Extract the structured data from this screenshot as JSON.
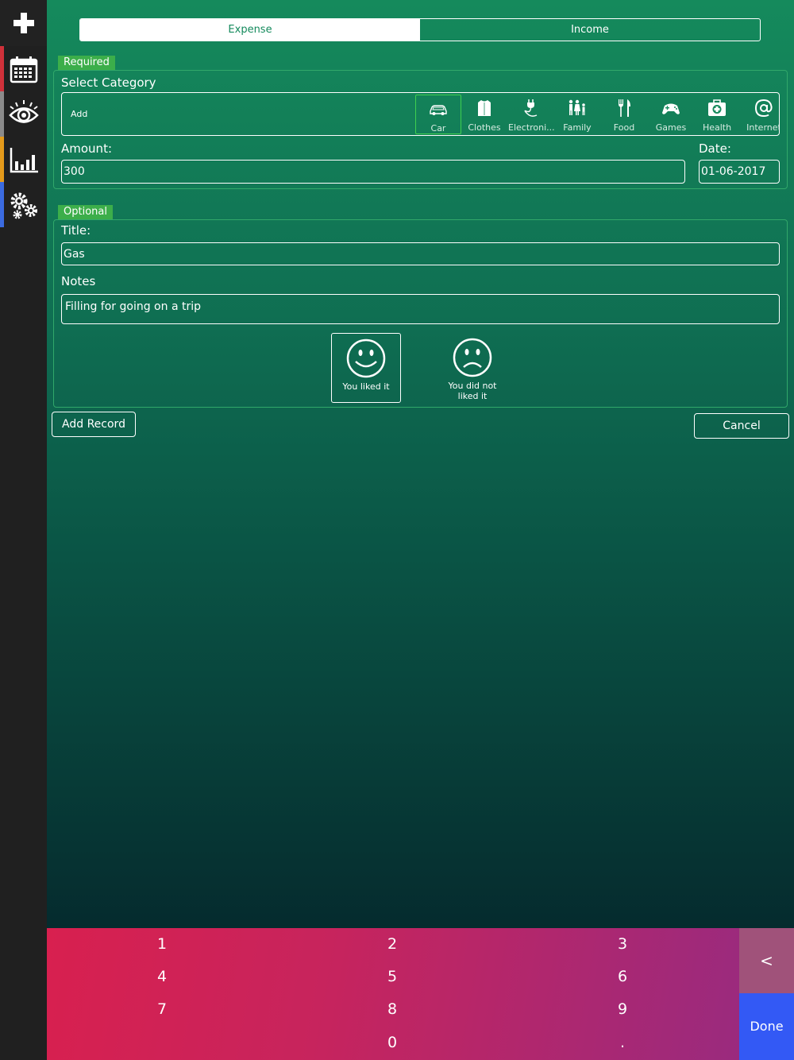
{
  "sidebar": {
    "add_icon": "plus-icon",
    "items": [
      {
        "icon": "calendar-icon",
        "stripe": "#d0313a"
      },
      {
        "icon": "eye-icon",
        "stripe": "#8a8a8a"
      },
      {
        "icon": "bar-chart-icon",
        "stripe": "#e39a1b"
      },
      {
        "icon": "gears-icon",
        "stripe": "#3b6be0"
      }
    ]
  },
  "segment": {
    "expense": "Expense",
    "income": "Income",
    "selected": "Expense"
  },
  "required": {
    "tag": "Required",
    "select_category": "Select Category",
    "add_label": "Add",
    "categories": [
      {
        "label": "Car",
        "icon": "car-icon",
        "selected": true
      },
      {
        "label": "Clothes",
        "icon": "shirt-icon"
      },
      {
        "label": "Electroni...",
        "icon": "plug-icon"
      },
      {
        "label": "Family",
        "icon": "family-icon"
      },
      {
        "label": "Food",
        "icon": "fork-knife-icon"
      },
      {
        "label": "Games",
        "icon": "gamepad-icon"
      },
      {
        "label": "Health",
        "icon": "first-aid-icon"
      },
      {
        "label": "Internet",
        "icon": "at-sign-icon"
      }
    ],
    "amount_label": "Amount:",
    "amount_value": "300",
    "date_label": "Date:",
    "date_value": "01-06-2017"
  },
  "optional": {
    "tag": "Optional",
    "title_label": "Title:",
    "title_value": "Gas",
    "notes_label": "Notes",
    "notes_value": "Filling for going on a trip",
    "liked": "You liked it",
    "not_liked": "You did not liked it",
    "selected_mood": "liked"
  },
  "actions": {
    "add_record": "Add Record",
    "cancel": "Cancel"
  },
  "keypad": {
    "keys": [
      "1",
      "2",
      "3",
      "4",
      "5",
      "6",
      "7",
      "8",
      "9",
      "0",
      "."
    ],
    "back": "<",
    "done": "Done"
  },
  "colors": {
    "accent": "#148a5c",
    "keypad": "#d8204f",
    "done": "#3359f5",
    "selected_category": "#3fd04f"
  }
}
